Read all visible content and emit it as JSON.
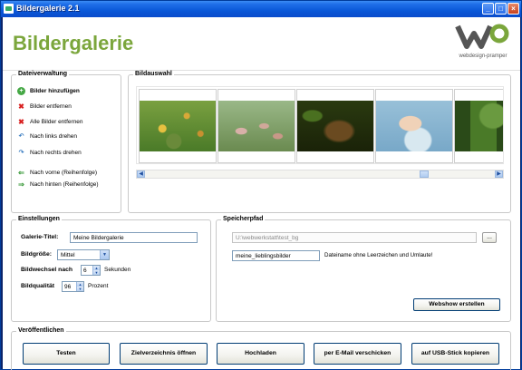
{
  "window": {
    "title": "Bildergalerie 2.1",
    "minimize": "_",
    "maximize": "□",
    "close": "×"
  },
  "header": {
    "app_title": "Bildergalerie",
    "logo_text": "webdesign-pramper"
  },
  "dateiverwaltung": {
    "label": "Dateiverwaltung",
    "actions": [
      {
        "label": "Bilder hinzufügen",
        "icon": "add-icon"
      },
      {
        "label": "Bilder entfernen",
        "icon": "remove-icon"
      },
      {
        "label": "Alle Bilder entfernen",
        "icon": "remove-all-icon"
      },
      {
        "label": "Nach links drehen",
        "icon": "rotate-left-icon"
      },
      {
        "label": "Nach rechts drehen",
        "icon": "rotate-right-icon"
      },
      {
        "label": "Nach vorne (Reihenfolge)",
        "icon": "arrow-left-icon"
      },
      {
        "label": "Nach hinten (Reihenfolge)",
        "icon": "arrow-right-icon"
      }
    ]
  },
  "bildauswahl": {
    "label": "Bildauswahl",
    "thumbnail_count": 5
  },
  "einstellungen": {
    "label": "Einstellungen",
    "galerie_titel_label": "Galerie-Titel:",
    "galerie_titel_value": "Meine Bildergalerie",
    "bildgroesse_label": "Bildgröße:",
    "bildgroesse_value": "Mittel",
    "bildwechsel_label": "Bildwechsel nach",
    "bildwechsel_value": "6",
    "bildwechsel_unit": "Sekunden",
    "bildqualitaet_label": "Bildqualität",
    "bildqualitaet_value": "96",
    "bildqualitaet_unit": "Prozent"
  },
  "speicherpfad": {
    "label": "Speicherpfad",
    "path_value": "U:\\webwerkstatt\\test_bg",
    "browse_label": "...",
    "folder_value": "meine_lieblingsbilder",
    "folder_hint": "Dateiname ohne Leerzeichen und Umlaute!",
    "create_button": "Webshow erstellen"
  },
  "veroeffentlichen": {
    "label": "Veröffentlichen",
    "buttons": [
      "Testen",
      "Zielverzeichnis öffnen",
      "Hochladen",
      "per E-Mail verschicken",
      "auf USB-Stick kopieren"
    ]
  }
}
